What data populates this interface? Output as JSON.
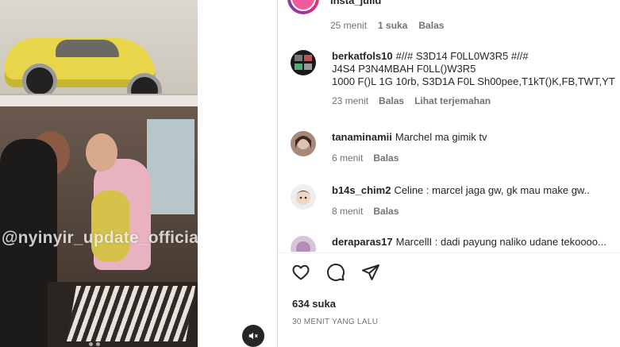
{
  "post": {
    "username": "insta_julid",
    "watermark": "@nyinyir_update_official",
    "likes": "634 suka",
    "time_ago": "30 MENIT YANG LALU"
  },
  "previous_comment_meta": {
    "time": "25 menit",
    "likes": "1 suka",
    "reply": "Balas"
  },
  "comments": [
    {
      "username": "berkatfols10",
      "lines": [
        "#//# S3D14 F0LL0W3R5 #//#",
        "J4S4 P3N4MBAH F0LL()W3R5",
        "1000 F()L 1G 10rb, S3D1A F0L Sh00pee,T1kT()K,FB,TWT,YT"
      ],
      "time": "23 menit",
      "reply": "Balas",
      "translate": "Lihat terjemahan"
    },
    {
      "username": "tanaminamii",
      "text": "Marchel ma gimik tv",
      "time": "6 menit",
      "reply": "Balas"
    },
    {
      "username": "b14s_chim2",
      "text": "Celine : marcel jaga gw, gk mau make gw..",
      "time": "8 menit",
      "reply": "Balas"
    },
    {
      "username": "deraparas17",
      "text": "MarcellI : dadi payung naliko udane tekoooo..."
    }
  ],
  "icons": {
    "like": "heart-icon",
    "comment": "comment-bubble-icon",
    "share": "paper-plane-icon",
    "mute": "speaker-muted-icon"
  }
}
